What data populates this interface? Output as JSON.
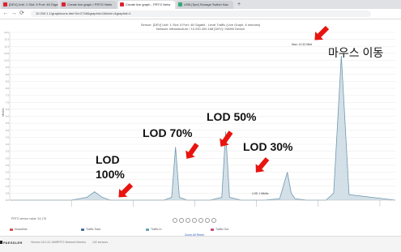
{
  "browser": {
    "tabs": [
      {
        "label": "[DEV] Unit: 1 Slot: 5 Port: 48 Giga"
      },
      {
        "label": "Create live graph / PRTG Netw"
      },
      {
        "label": "Create live graph - PRTG Netw"
      },
      {
        "label": "USB [Spe] Storage Switch Nav"
      }
    ],
    "new_tab": "+",
    "url": "10.200.1.1/graphicons.htm?id=2748&graphid=0&hide=&graphid=1",
    "nav": {
      "back": "←",
      "forward": "→",
      "reload": "⟳"
    }
  },
  "page": {
    "header_line1": "Sensor: [DEV] Unit: 1 Slot: 5 Port: 48 Gigabit - Level Traffic (Live Graph, 6 minutes)",
    "header_line2": "Network Infrastructure / 10.200.200.168 [DEV] / NIMM Device",
    "y_axis_label": "Mbit/s",
    "max_label": "Max: 10.32 Mbit",
    "small_peak_label": "LOD 1 Mbit/s",
    "bottom_left_note": "PRTG sensor value: 24,175",
    "legend": [
      {
        "label": "Downtime",
        "color": "#e05050"
      },
      {
        "label": "Traffic Total",
        "color": "#4a6fa5"
      },
      {
        "label": "Traffic In",
        "color": "#6aa5b5"
      },
      {
        "label": "Traffic Out",
        "color": "#c05080"
      }
    ],
    "zoom_links": "Zoom All   Reset"
  },
  "callouts": {
    "lod100_line1": "LOD",
    "lod100_line2": "100%",
    "lod70": "LOD 70%",
    "lod50": "LOD 50%",
    "lod30": "LOD 30%",
    "mouse_move": "마우스 이동"
  },
  "footer": {
    "brand": "PAESSLER",
    "text1": "Version 18.2.41.1652",
    "text2": "PRTG Network Monitor",
    "text3": "102 sensors"
  },
  "colors": {
    "arrow": "#e8140f",
    "series_fill": "#c8d8e2",
    "series_stroke": "#6f98ad",
    "grid": "#e3e3e3"
  },
  "chart_data": {
    "type": "area",
    "title": "",
    "ylabel": "Mbit/s",
    "ylim": [
      0,
      12
    ],
    "yticks": [
      0,
      0.5,
      1,
      1.5,
      2,
      2.5,
      3,
      3.5,
      4,
      4.5,
      5,
      5.5,
      6,
      6.5,
      7,
      7.5,
      8,
      8.5,
      9,
      9.5,
      10,
      10.5,
      11,
      11.5,
      12
    ],
    "series": [
      {
        "name": "Traffic In",
        "x": [
          0,
          8,
          16,
          20,
          22,
          24,
          26,
          28,
          34,
          40,
          42,
          43,
          44,
          46,
          52,
          55,
          56,
          57,
          60,
          66,
          70,
          72,
          73,
          74,
          77,
          82,
          84,
          86,
          88,
          100
        ],
        "values": [
          0,
          0,
          0,
          0.2,
          0.6,
          0.2,
          0,
          0,
          0,
          0,
          0.2,
          3.8,
          0.2,
          0,
          0,
          0.2,
          4.9,
          0.2,
          0,
          0,
          0.1,
          2.0,
          0.5,
          0.1,
          0,
          0,
          0.5,
          10.32,
          0.4,
          0
        ]
      }
    ]
  }
}
